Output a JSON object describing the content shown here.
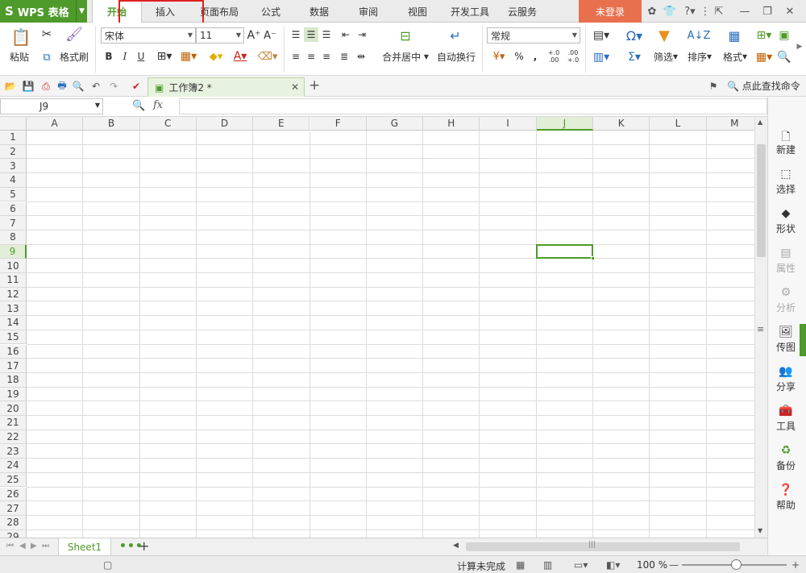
{
  "app": {
    "logo_letter": "S",
    "name": "WPS 表格"
  },
  "menu": {
    "tabs": [
      {
        "label": "开始",
        "active": true
      },
      {
        "label": "插入",
        "active": false
      },
      {
        "label": "页面布局",
        "active": false
      },
      {
        "label": "公式",
        "active": false
      },
      {
        "label": "数据",
        "active": false
      },
      {
        "label": "审阅",
        "active": false
      },
      {
        "label": "视图",
        "active": false
      },
      {
        "label": "开发工具",
        "active": false
      },
      {
        "label": "云服务",
        "active": false
      }
    ],
    "login_label": "未登录"
  },
  "ribbon": {
    "paste_label": "粘贴",
    "format_painter_label": "格式刷",
    "font_name": "宋体",
    "font_size": "11",
    "merge_center_label": "合并居中",
    "wrap_text_label": "自动换行",
    "number_format": "常规",
    "percent_symbol": "%",
    "comma_symbol": ",",
    "increase_decimal": "+.0 .00",
    "decrease_decimal": ".00 +.0",
    "filter_label": "筛选",
    "sort_label": "排序",
    "format_label": "格式",
    "bold": "B",
    "italic": "I",
    "underline": "U"
  },
  "document": {
    "tab_title": "工作簿2 *",
    "find_command_label": "点此查找命令"
  },
  "formula": {
    "cell_reference": "J9",
    "fx_label": "fx"
  },
  "grid": {
    "columns": [
      "A",
      "B",
      "C",
      "D",
      "E",
      "F",
      "G",
      "H",
      "I",
      "J",
      "K",
      "L",
      "M"
    ],
    "rows": [
      "1",
      "2",
      "3",
      "4",
      "5",
      "6",
      "7",
      "8",
      "9",
      "10",
      "11",
      "12",
      "13",
      "14",
      "15",
      "16",
      "17",
      "18",
      "19",
      "20",
      "21",
      "22",
      "23",
      "24",
      "25",
      "26",
      "27",
      "28",
      "29"
    ],
    "selected_column": "J",
    "selected_row": "9"
  },
  "sidepanel": {
    "items": [
      {
        "label": "新建",
        "icon": "new-icon",
        "enabled": true
      },
      {
        "label": "选择",
        "icon": "select-icon",
        "enabled": true
      },
      {
        "label": "形状",
        "icon": "shape-icon",
        "enabled": true
      },
      {
        "label": "属性",
        "icon": "properties-icon",
        "enabled": false
      },
      {
        "label": "分析",
        "icon": "analysis-icon",
        "enabled": false
      },
      {
        "label": "传图",
        "icon": "upload-image-icon",
        "enabled": true
      },
      {
        "label": "分享",
        "icon": "share-icon",
        "enabled": true
      },
      {
        "label": "工具",
        "icon": "toolbox-icon",
        "enabled": true
      },
      {
        "label": "备份",
        "icon": "backup-icon",
        "enabled": true
      },
      {
        "label": "帮助",
        "icon": "help-icon",
        "enabled": true
      }
    ]
  },
  "sheets": {
    "active_sheet": "Sheet1",
    "more": "•••",
    "add": "+"
  },
  "status": {
    "text": "计算未完成",
    "zoom": "100 %",
    "zoom_minus": "—",
    "zoom_plus": "+"
  },
  "colors": {
    "accent": "#4e9a2a",
    "login_bg": "#e8704f",
    "highlight_box": "#e02020"
  }
}
